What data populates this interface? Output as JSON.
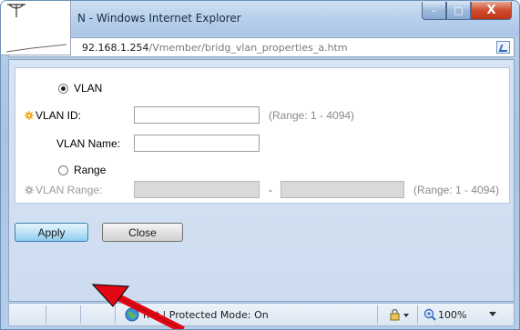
{
  "window": {
    "title": "N - Windows Internet Explorer",
    "controls": {
      "minimize": "–",
      "maximize": "□",
      "close": "X"
    }
  },
  "address": {
    "host": "92.168.1.254",
    "path": "/Vmember/bridg_vlan_properties_a.htm"
  },
  "form": {
    "vlan_option": "VLAN",
    "vlan_id_label": "VLAN ID:",
    "vlan_id_value": "",
    "vlan_id_hint": "(Range: 1 - 4094)",
    "vlan_name_label": "VLAN Name:",
    "vlan_name_value": "",
    "range_option": "Range",
    "vlan_range_label": "VLAN Range:",
    "range_separator": "-",
    "vlan_range_hint": "(Range: 1 - 4094)",
    "selected": "VLAN"
  },
  "buttons": {
    "apply": "Apply",
    "close": "Close"
  },
  "status": {
    "zone_text": "net | Protected Mode: On",
    "zoom": "100%"
  },
  "colors": {
    "annotation_arrow": "#e30613",
    "required_marker": "#f0a30a"
  },
  "icons": [
    "antenna-icon",
    "page-compat-icon",
    "required-gear-icon",
    "globe-icon",
    "security-lock-icon",
    "zoom-icon"
  ]
}
